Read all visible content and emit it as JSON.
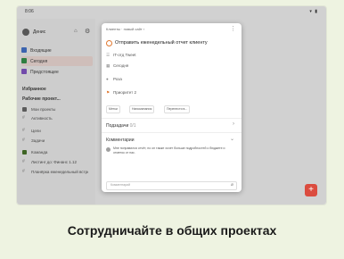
{
  "status_bar": {
    "time": "8:06",
    "icons": "▾ ▮"
  },
  "sidebar": {
    "user_name": "Денис",
    "nav": [
      {
        "label": "Входящие",
        "icon_color": "#4a7bd6",
        "icon": "inbox-icon"
      },
      {
        "label": "Сегодня",
        "icon_color": "#3a9a50",
        "icon": "calendar-icon"
      },
      {
        "label": "Предстоящее",
        "icon_color": "#8b5bd1",
        "icon": "upcoming-icon"
      }
    ],
    "favorites_label": "Избранное",
    "projects_label": "Рабочие проект...",
    "projects": [
      {
        "label": "Мои проекты",
        "kind": "sq",
        "color": "#6f6f6f"
      },
      {
        "label": "Активность",
        "kind": "hash"
      },
      {
        "label": "Цели",
        "kind": "hash"
      },
      {
        "label": "Задачи",
        "kind": "hash"
      },
      {
        "label": "Команда",
        "kind": "sq",
        "color": "#4c7a2c"
      },
      {
        "label": "Листинг до: Финанс 1.12",
        "kind": "hash"
      },
      {
        "label": "Планёрка еженедельный встреч...",
        "kind": "hash"
      }
    ]
  },
  "modal": {
    "breadcrumb": "Клиенты · новый сайт ›",
    "task_title": "Отправить еженедельный отчет клиенту",
    "rows": [
      {
        "icon": "☰",
        "icon_name": "project-icon",
        "text": "IT-отд Tweet"
      },
      {
        "icon": "▦",
        "icon_name": "calendar-icon",
        "text": "Сегодня"
      },
      {
        "icon": "●",
        "icon_name": "avatar-icon",
        "text": "Роза"
      },
      {
        "icon": "⚑",
        "icon_name": "flag-icon",
        "text": "Приоритет 2"
      }
    ],
    "chips": [
      "Метки",
      "Напоминания",
      "Перенести в..."
    ],
    "subtasks_label": "Подзадачи",
    "subtasks_count": "0/1",
    "comments_label": "Комментарии",
    "comment_text": "Мне понравился отчёт, но он также хочет больше подробностей о бюджете и отметок от нас.",
    "comment_placeholder": "Комментарий"
  },
  "caption": "Сотрудничайте в общих проектах",
  "colors": {
    "accent": "#db4c3f",
    "background": "#eef3e1"
  }
}
